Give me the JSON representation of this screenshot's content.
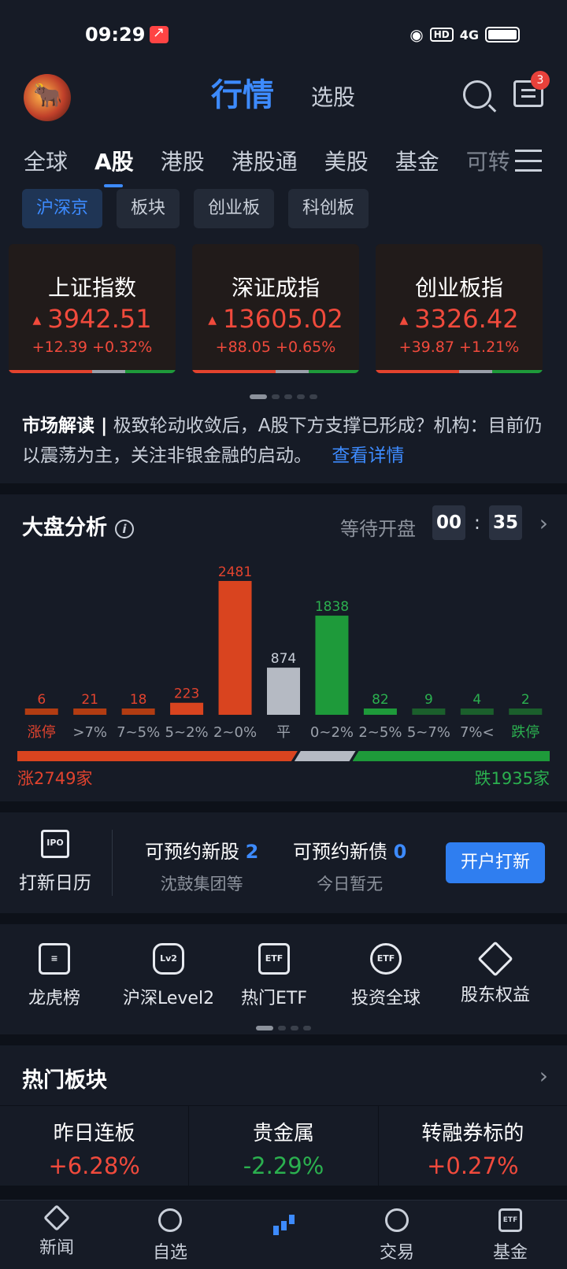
{
  "status": {
    "time": "09:29",
    "hd": "HD",
    "signal": "4G"
  },
  "header": {
    "title": "行情",
    "alt_tab": "选股",
    "message_count": "3"
  },
  "market_tabs": [
    "全球",
    "A股",
    "港股",
    "港股通",
    "美股",
    "基金",
    "可转"
  ],
  "sub_tabs": [
    "沪深京",
    "板块",
    "创业板",
    "科创板"
  ],
  "indices": [
    {
      "name": "上证指数",
      "price": "3942.51",
      "change": "+12.39 +0.32%"
    },
    {
      "name": "深证成指",
      "price": "13605.02",
      "change": "+88.05 +0.65%"
    },
    {
      "name": "创业板指",
      "price": "3326.42",
      "change": "+39.87 +1.21%"
    }
  ],
  "news": {
    "tag": "市场解读 |",
    "text": "极致轮动收敛后，A股下方支撑已形成？机构：目前仍以震荡为主，关注非银金融的启动。",
    "link": "查看详情"
  },
  "analysis": {
    "title": "大盘分析",
    "info": "i",
    "waiting": "等待开盘",
    "countdown_h": "00",
    "countdown_sep": ":",
    "countdown_m": "35",
    "up_label": "涨2749家",
    "down_label": "跌1935家"
  },
  "chart_data": {
    "type": "bar",
    "categories": [
      "涨停",
      ">7%",
      "7~5%",
      "5~2%",
      "2~0%",
      "平",
      "0~2%",
      "2~5%",
      "5~7%",
      "7%<",
      "跌停"
    ],
    "values": [
      6,
      21,
      18,
      223,
      2481,
      874,
      1838,
      82,
      9,
      4,
      2
    ],
    "colors": {
      "up": "#b23c12",
      "up_bright": "#d9441f",
      "flat": "#b5bac3",
      "down": "#1e9a3a",
      "down_dim": "#1b5f2c",
      "up_text": "#e2432e",
      "down_text": "#2bb04f",
      "flat_text": "#c9cfd9",
      "neutral_text": "#9aa0aa"
    }
  },
  "ipo": {
    "label": "打新日历",
    "icon": "IPO",
    "stock_title": "可预约新股",
    "stock_count": "2",
    "stock_sub": "沈鼓集团等",
    "bond_title": "可预约新债",
    "bond_count": "0",
    "bond_sub": "今日暂无",
    "button": "开户打新"
  },
  "tools": [
    {
      "label": "龙虎榜",
      "icon": "list-icon"
    },
    {
      "label": "沪深Level2",
      "icon": "lv2-icon"
    },
    {
      "label": "热门ETF",
      "icon": "etf-icon"
    },
    {
      "label": "投资全球",
      "icon": "globe-etf-icon"
    },
    {
      "label": "股东权益",
      "icon": "diamond-icon"
    }
  ],
  "tool_icon_text": {
    "lv2": "Lv2",
    "etf": "ETF",
    "globe": "ETF"
  },
  "hot": {
    "title": "热门板块",
    "items": [
      {
        "name": "昨日连板",
        "value": "+6.28%",
        "color": "#f04a3c"
      },
      {
        "name": "贵金属",
        "value": "-2.29%",
        "color": "#2bb04f"
      },
      {
        "name": "转融券标的",
        "value": "+0.27%",
        "color": "#f04a3c"
      }
    ]
  },
  "nav": [
    "新闻",
    "自选",
    "",
    "交易",
    "基金"
  ],
  "nav_fund_icon": "ETF"
}
